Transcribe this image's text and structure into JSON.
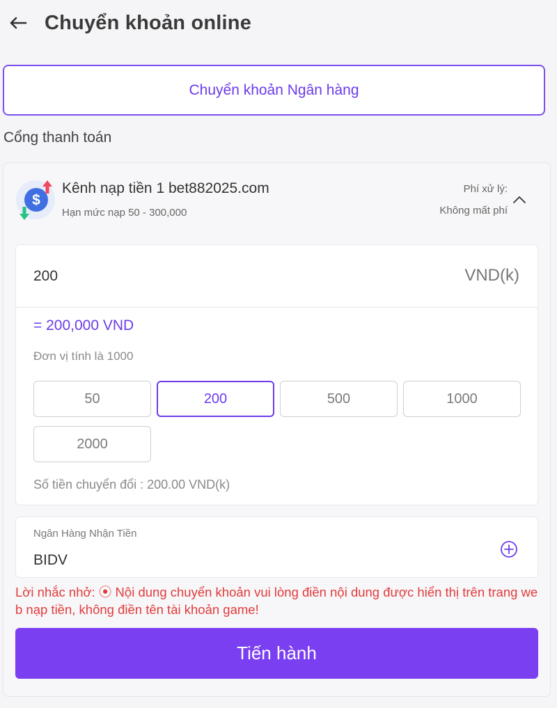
{
  "header": {
    "title": "Chuyển khoản online",
    "back_icon": "arrow-left-icon"
  },
  "method_tab": {
    "label": "Chuyển khoản Ngân hàng"
  },
  "section": {
    "label": "Cổng thanh toán"
  },
  "channel": {
    "icon": "dollar-coin-transfer-icon",
    "name": "Kênh nạp tiền 1 bet882025.com",
    "limit": "Hạn mức nạp 50 - 300,000",
    "fee_label": "Phí xử lý:",
    "fee_value": "Không mất phí"
  },
  "amount": {
    "value": "200",
    "unit": "VND(k)",
    "converted": "= 200,000 VND",
    "unit_note": "Đơn vị tính là 1000",
    "chips": [
      "50",
      "200",
      "500",
      "1000",
      "2000"
    ],
    "selected_chip": "200",
    "conversion_note": "Số tiền chuyển đổi : 200.00 VND(k)"
  },
  "bank": {
    "label": "Ngân Hàng Nhận Tiền",
    "value": "BIDV"
  },
  "reminder": "Lời nhắc nhở: ⦿ Nội dung chuyển khoản vui lòng điền nội dung được hiển thị trên trang web nạp tiền, không điền tên tài khoản game!",
  "submit_label": "Tiến hành",
  "colors": {
    "accent": "#7b3ff2",
    "warning": "#e23b3b",
    "background": "#f5f5f7"
  }
}
